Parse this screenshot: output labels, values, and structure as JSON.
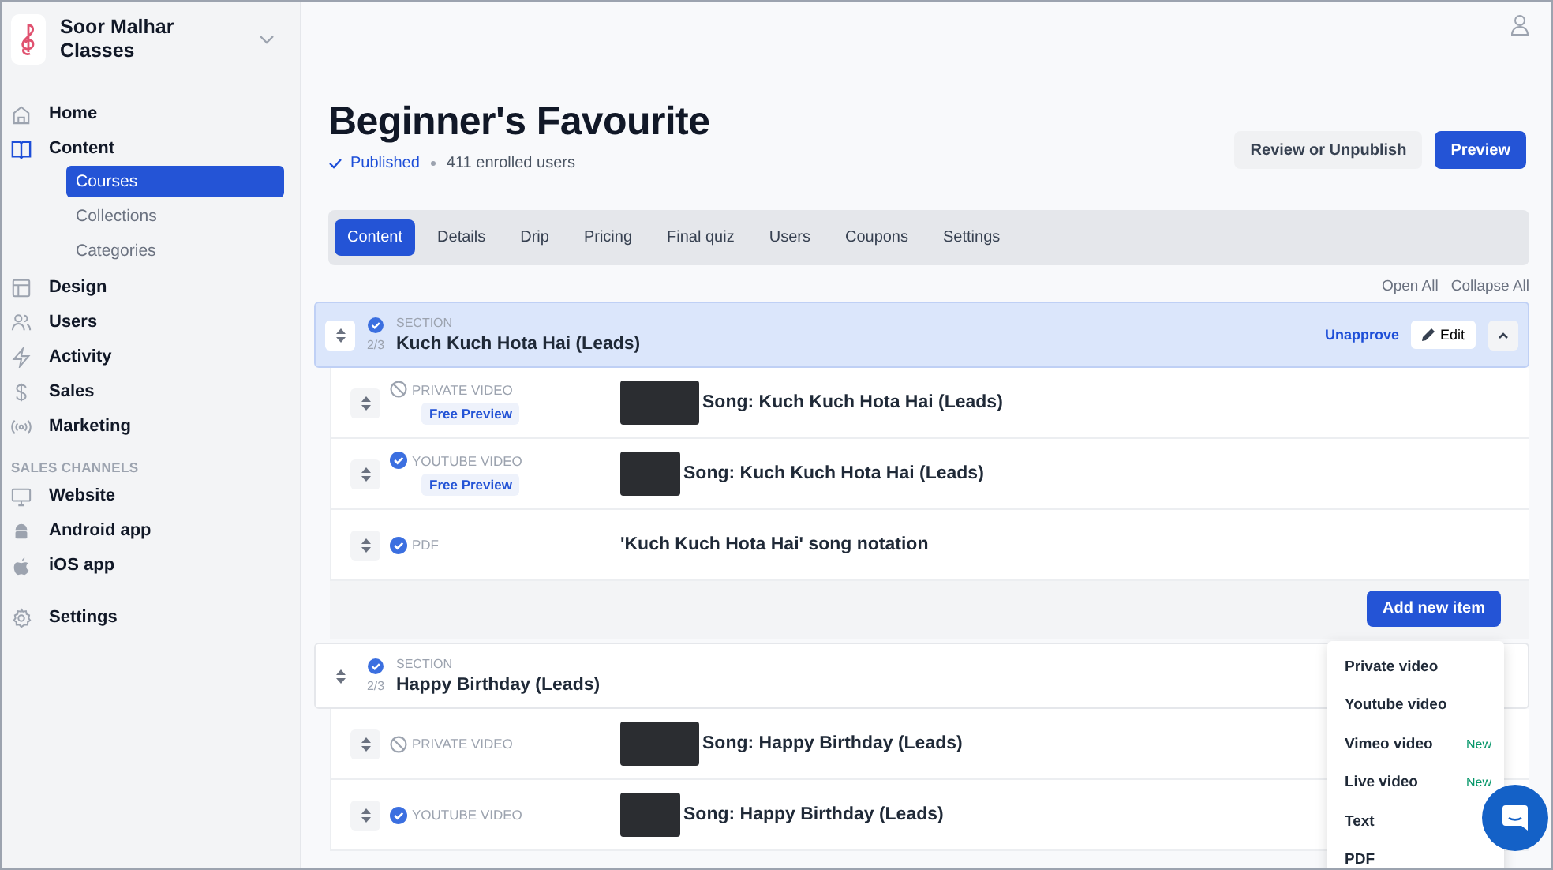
{
  "sidebar": {
    "brand": "Soor Malhar Classes",
    "nav": [
      {
        "label": "Home"
      },
      {
        "label": "Content",
        "children": [
          {
            "label": "Courses",
            "selected": true
          },
          {
            "label": "Collections",
            "selected": false
          },
          {
            "label": "Categories",
            "selected": false
          }
        ]
      },
      {
        "label": "Design"
      },
      {
        "label": "Users"
      },
      {
        "label": "Activity"
      },
      {
        "label": "Sales"
      },
      {
        "label": "Marketing"
      }
    ],
    "channels_heading": "SALES CHANNELS",
    "channels": [
      {
        "label": "Website"
      },
      {
        "label": "Android app"
      },
      {
        "label": "iOS app"
      }
    ],
    "settings": "Settings"
  },
  "course": {
    "title": "Beginner's Favourite",
    "status": "Published",
    "meta": "411 enrolled users"
  },
  "buttons": {
    "review": "Review or Unpublish",
    "preview": "Preview"
  },
  "tabs": [
    {
      "label": "Content",
      "selected": true
    },
    {
      "label": "Details",
      "selected": false
    },
    {
      "label": "Drip",
      "selected": false
    },
    {
      "label": "Pricing",
      "selected": false
    },
    {
      "label": "Final quiz",
      "selected": false
    },
    {
      "label": "Users",
      "selected": false
    },
    {
      "label": "Coupons",
      "selected": false
    },
    {
      "label": "Settings",
      "selected": false
    }
  ],
  "open_all": "Open All",
  "collapse_all": "Collapse All",
  "sections": [
    {
      "label": "SECTION",
      "count": "2/3",
      "title": "Kuch Kuch Hota Hai (Leads)",
      "selected": true,
      "expanded": true,
      "unapprove": "Unapprove",
      "edit": "Edit",
      "add_label": "Add new item",
      "items": [
        {
          "kind": "private",
          "type_label": "PRIVATE VIDEO",
          "published": false,
          "tag": "Free Preview",
          "title": "Song: Kuch Kuch Hota Hai (Leads)"
        },
        {
          "kind": "youtube",
          "type_label": "YOUTUBE VIDEO",
          "published": true,
          "tag": "Free Preview",
          "title": "Song: Kuch Kuch Hota Hai (Leads)"
        },
        {
          "kind": "pdf",
          "type_label": "PDF",
          "published": true,
          "title": "'Kuch Kuch Hota Hai' song notation"
        }
      ]
    },
    {
      "label": "SECTION",
      "count": "2/3",
      "title": "Happy Birthday (Leads)",
      "selected": false,
      "items": [
        {
          "kind": "private",
          "type_label": "PRIVATE VIDEO",
          "published": false,
          "title": "Song: Happy Birthday (Leads)"
        },
        {
          "kind": "youtube",
          "type_label": "YOUTUBE VIDEO",
          "published": true,
          "title": "Song: Happy Birthday (Leads)"
        }
      ]
    }
  ],
  "add_menu": [
    {
      "label": "Private video"
    },
    {
      "label": "Youtube video"
    },
    {
      "label": "Vimeo video",
      "badge": "New"
    },
    {
      "label": "Live video",
      "badge": "New"
    },
    {
      "label": "Text"
    },
    {
      "label": "PDF"
    }
  ]
}
